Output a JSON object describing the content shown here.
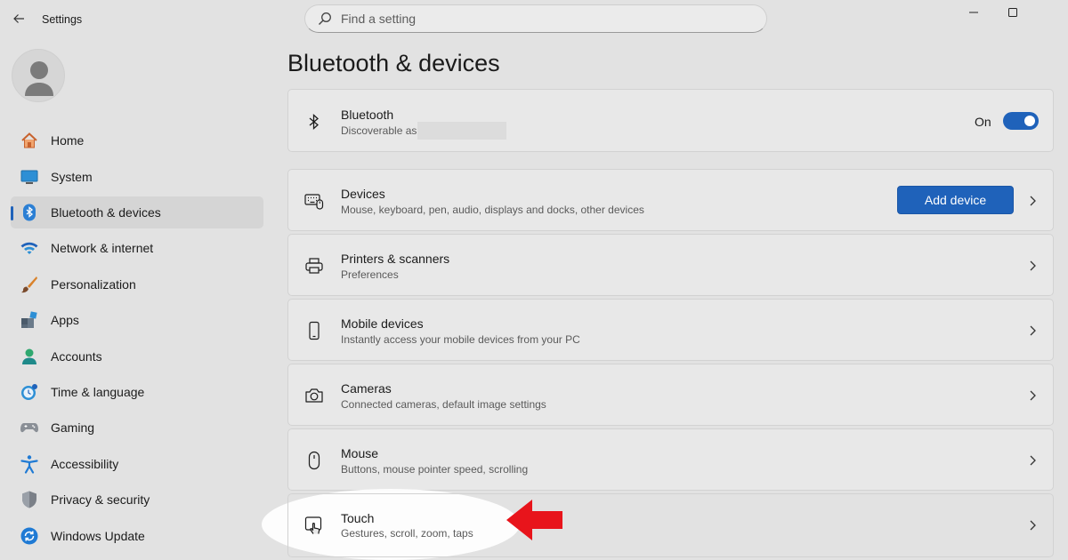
{
  "window": {
    "title": "Settings"
  },
  "search": {
    "placeholder": "Find a setting"
  },
  "sidebar": {
    "items": [
      {
        "label": "Home",
        "icon": "home-icon"
      },
      {
        "label": "System",
        "icon": "system-icon"
      },
      {
        "label": "Bluetooth & devices",
        "icon": "bluetooth-icon",
        "selected": true
      },
      {
        "label": "Network & internet",
        "icon": "wifi-icon"
      },
      {
        "label": "Personalization",
        "icon": "brush-icon"
      },
      {
        "label": "Apps",
        "icon": "apps-icon"
      },
      {
        "label": "Accounts",
        "icon": "accounts-icon"
      },
      {
        "label": "Time & language",
        "icon": "clock-globe-icon"
      },
      {
        "label": "Gaming",
        "icon": "gamepad-icon"
      },
      {
        "label": "Accessibility",
        "icon": "accessibility-icon"
      },
      {
        "label": "Privacy & security",
        "icon": "shield-icon"
      },
      {
        "label": "Windows Update",
        "icon": "update-icon"
      }
    ]
  },
  "main": {
    "title": "Bluetooth & devices",
    "bluetooth": {
      "title": "Bluetooth",
      "subtitle": "Discoverable as",
      "toggle_label": "On",
      "toggle_on": true
    },
    "devices": {
      "title": "Devices",
      "subtitle": "Mouse, keyboard, pen, audio, displays and docks, other devices",
      "button_label": "Add device"
    },
    "printers": {
      "title": "Printers & scanners",
      "subtitle": "Preferences"
    },
    "mobile": {
      "title": "Mobile devices",
      "subtitle": "Instantly access your mobile devices from your PC"
    },
    "cameras": {
      "title": "Cameras",
      "subtitle": "Connected cameras, default image settings"
    },
    "mouse": {
      "title": "Mouse",
      "subtitle": "Buttons, mouse pointer speed, scrolling"
    },
    "touch": {
      "title": "Touch",
      "subtitle": "Gestures, scroll, zoom, taps"
    }
  },
  "colors": {
    "accent": "#1f62ba",
    "background": "#e2e2e2",
    "card": "#e8e8e8",
    "annotation_arrow": "#e8141b"
  }
}
